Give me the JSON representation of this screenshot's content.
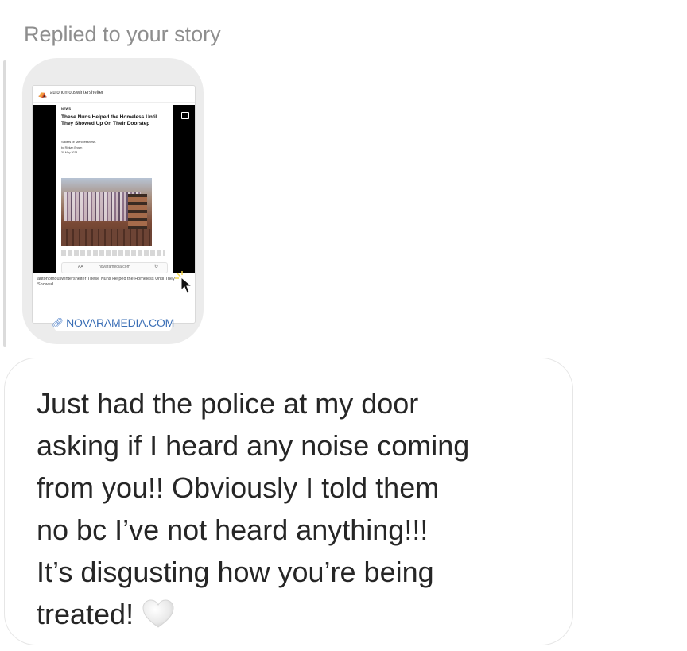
{
  "header": {
    "replied_label": "Replied to your story"
  },
  "story": {
    "account_name": "autonomouswintershelter",
    "article": {
      "kicker": "NEWS",
      "title": "These Nuns Helped the Homeless Until They Showed Up On Their Doorstep",
      "subtitle": "Sisters of Mercilessness.",
      "byline": "by Rivkah Brown",
      "date": "30 May 2023"
    },
    "browser_bar": {
      "aa_label": "AA",
      "url": "novaramedia.com",
      "reload_icon": "reload-icon"
    },
    "caption_account": "autonomouswintershelter",
    "caption_text": "These Nuns Helped the Homeless Until They Showed...",
    "link_label": "NOVARAMEDIA.COM",
    "link_icon": "link-icon"
  },
  "message": {
    "lines": [
      "Just had the police at my door",
      "asking if I heard any noise coming",
      "from you!! Obviously I told them",
      "no bc I’ve not heard anything!!!",
      "It’s disgusting how you’re being",
      "treated!"
    ],
    "emoji": "white-heart-icon"
  }
}
